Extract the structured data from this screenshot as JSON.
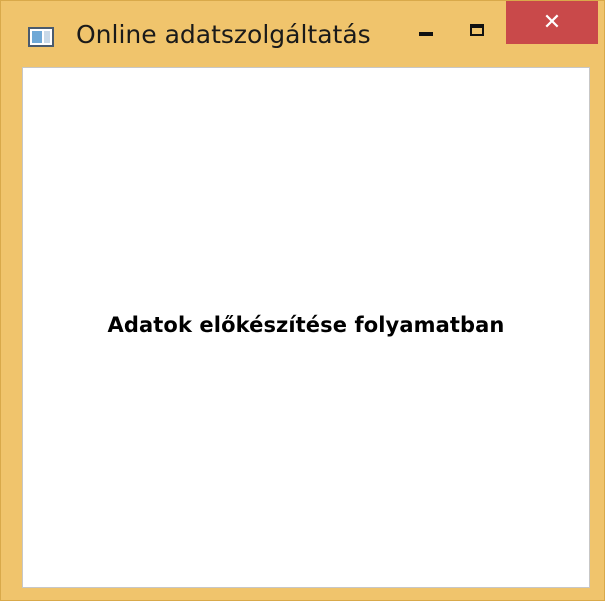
{
  "window": {
    "title": "Online adatszolgáltatás",
    "controls": {
      "minimize_icon": "minimize-icon",
      "maximize_icon": "maximize-icon",
      "close_glyph": "✕"
    },
    "colors": {
      "frame": "#f0c46c",
      "close_button": "#c9494a",
      "client_background": "#ffffff"
    }
  },
  "content": {
    "status_message": "Adatok előkészítése folyamatban"
  }
}
